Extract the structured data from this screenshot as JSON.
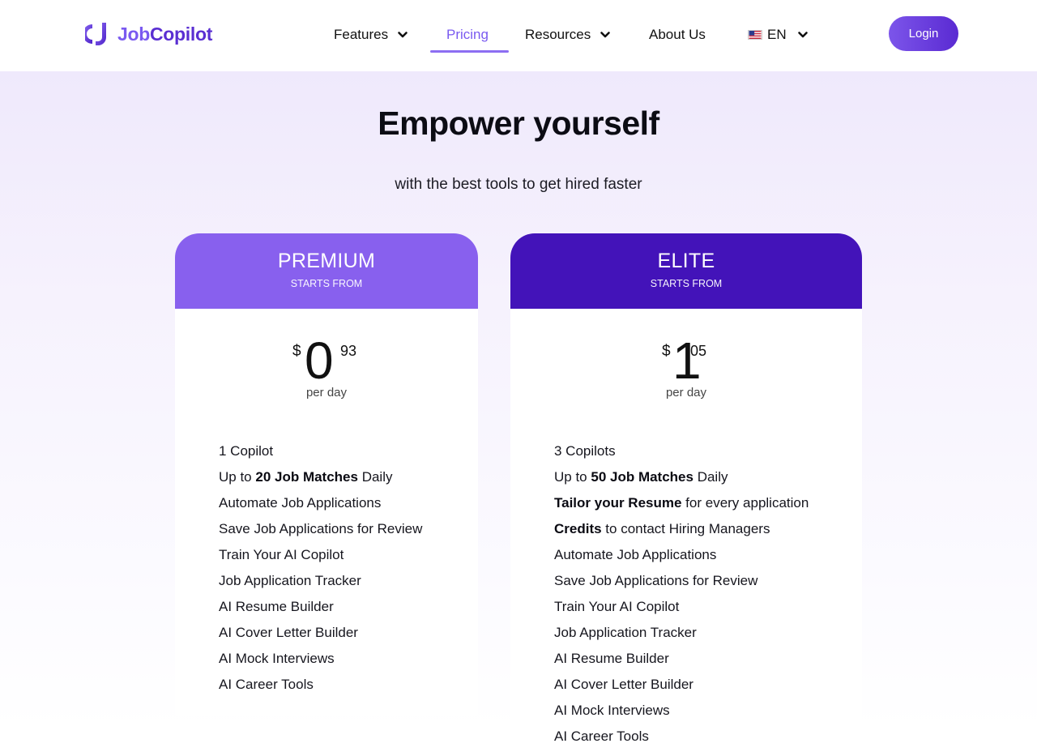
{
  "brand": {
    "name_part1": "Job",
    "name_part2": "Copilot"
  },
  "nav": {
    "features": "Features",
    "pricing": "Pricing",
    "resources": "Resources",
    "about": "About Us",
    "language": "EN",
    "login": "Login"
  },
  "hero": {
    "title": "Empower yourself",
    "subtitle": "with the best tools to get hired faster"
  },
  "plans": [
    {
      "name": "PREMIUM",
      "starts": "STARTS FROM",
      "currency": "$",
      "whole": "0",
      "cents": "93",
      "per": "per day",
      "features": [
        [
          {
            "t": "1 Copilot"
          }
        ],
        [
          {
            "t": "Up to "
          },
          {
            "t": "20 Job Matches",
            "b": true
          },
          {
            "t": " Daily"
          }
        ],
        [
          {
            "t": "Automate Job Applications"
          }
        ],
        [
          {
            "t": "Save Job Applications for Review"
          }
        ],
        [
          {
            "t": "Train Your AI Copilot"
          }
        ],
        [
          {
            "t": "Job Application Tracker"
          }
        ],
        [
          {
            "t": "AI Resume Builder"
          }
        ],
        [
          {
            "t": "AI Cover Letter Builder"
          }
        ],
        [
          {
            "t": "AI Mock Interviews"
          }
        ],
        [
          {
            "t": "AI Career Tools"
          }
        ]
      ]
    },
    {
      "name": "ELITE",
      "starts": "STARTS FROM",
      "currency": "$",
      "whole": "1",
      "cents": "05",
      "per": "per day",
      "features": [
        [
          {
            "t": "3 Copilots"
          }
        ],
        [
          {
            "t": "Up to "
          },
          {
            "t": "50 Job Matches",
            "b": true
          },
          {
            "t": " Daily"
          }
        ],
        [
          {
            "t": "Tailor your Resume",
            "b": true
          },
          {
            "t": " for every application"
          }
        ],
        [
          {
            "t": "Credits",
            "b": true
          },
          {
            "t": " to contact Hiring Managers"
          }
        ],
        [
          {
            "t": "Automate Job Applications"
          }
        ],
        [
          {
            "t": "Save Job Applications for Review"
          }
        ],
        [
          {
            "t": "Train Your AI Copilot"
          }
        ],
        [
          {
            "t": "Job Application Tracker"
          }
        ],
        [
          {
            "t": "AI Resume Builder"
          }
        ],
        [
          {
            "t": "AI Cover Letter Builder"
          }
        ],
        [
          {
            "t": "AI Mock Interviews"
          }
        ],
        [
          {
            "t": "AI Career Tools"
          }
        ]
      ]
    }
  ],
  "colors": {
    "accent": "#7a5af0",
    "premium_header": "#8860ee",
    "elite_header": "#4313b9",
    "hero_bg": "#efe9fc"
  },
  "icons": [
    "logo-mark",
    "chevron-down-icon",
    "us-flag-icon"
  ]
}
